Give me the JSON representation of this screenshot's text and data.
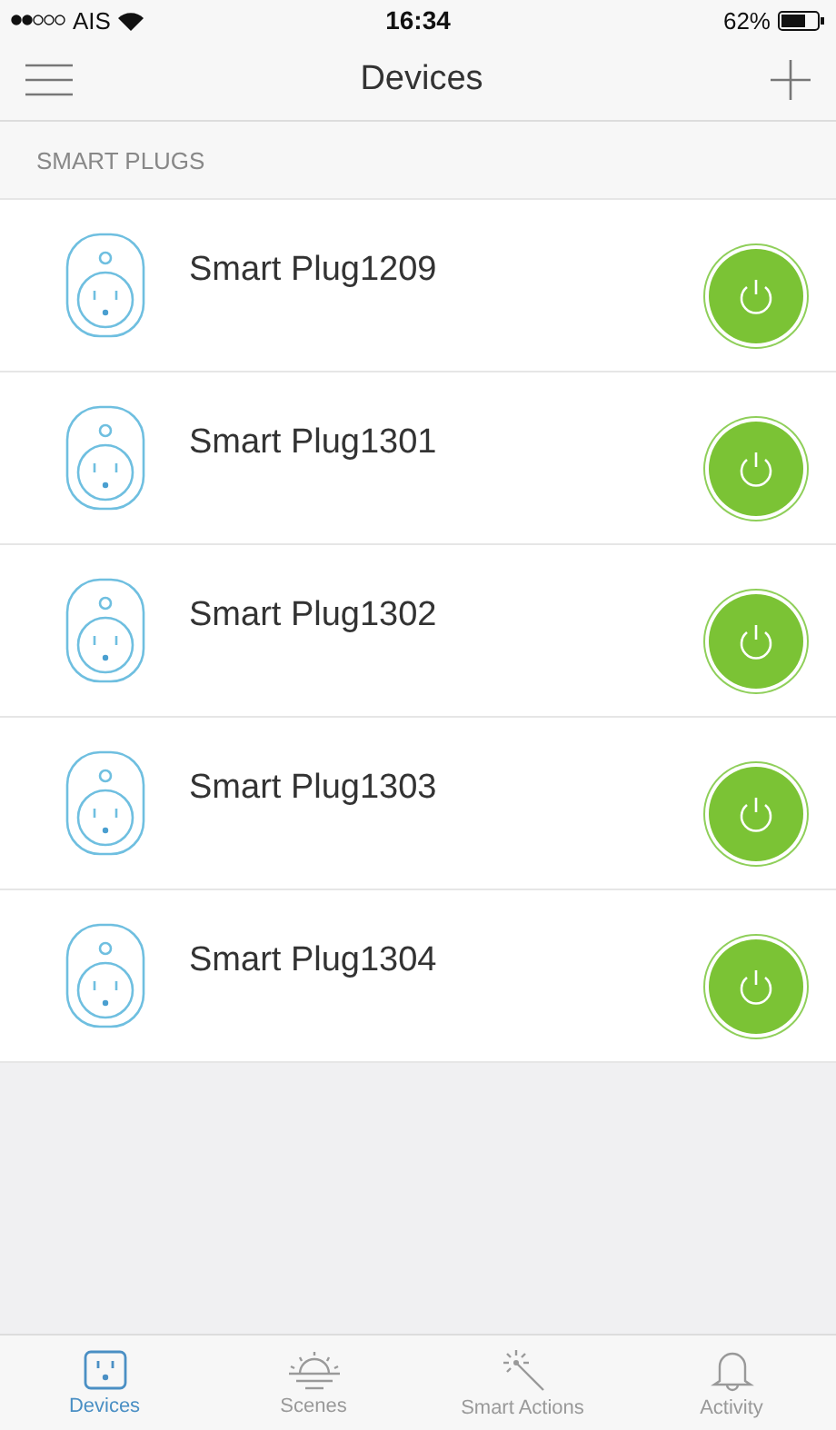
{
  "status_bar": {
    "carrier": "AIS",
    "time": "16:34",
    "battery": "62%"
  },
  "nav": {
    "title": "Devices"
  },
  "section": {
    "title": "SMART PLUGS"
  },
  "devices": [
    {
      "name": "Smart Plug1209",
      "on": true
    },
    {
      "name": "Smart Plug1301",
      "on": true
    },
    {
      "name": "Smart Plug1302",
      "on": true
    },
    {
      "name": "Smart Plug1303",
      "on": true
    },
    {
      "name": "Smart Plug1304",
      "on": true
    }
  ],
  "tabs": [
    {
      "label": "Devices",
      "kind": "plug",
      "selected": true
    },
    {
      "label": "Scenes",
      "kind": "sunrise",
      "selected": false
    },
    {
      "label": "Smart Actions",
      "kind": "wand",
      "selected": false
    },
    {
      "label": "Activity",
      "kind": "bell",
      "selected": false
    }
  ]
}
